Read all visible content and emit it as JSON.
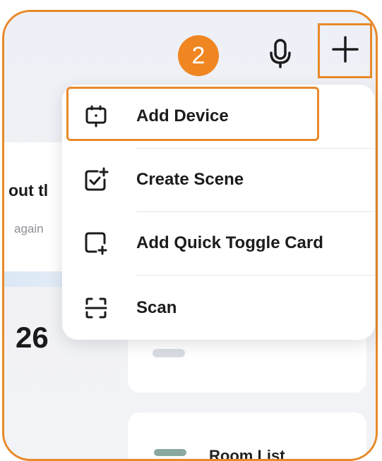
{
  "step_badge": "2",
  "background": {
    "partial_title": "out tl",
    "partial_subtitle": "again",
    "partial_number": "26",
    "room_list_label": "Room List"
  },
  "header": {
    "mic_icon": "microphone-icon",
    "add_icon": "plus-icon"
  },
  "menu": {
    "items": [
      {
        "label": "Add Device",
        "icon": "device-icon"
      },
      {
        "label": "Create Scene",
        "icon": "create-scene-icon"
      },
      {
        "label": "Add Quick Toggle Card",
        "icon": "add-card-icon"
      },
      {
        "label": "Scan",
        "icon": "scan-icon"
      }
    ]
  },
  "colors": {
    "highlight": "#e8892a",
    "badge": "#ef8622"
  }
}
